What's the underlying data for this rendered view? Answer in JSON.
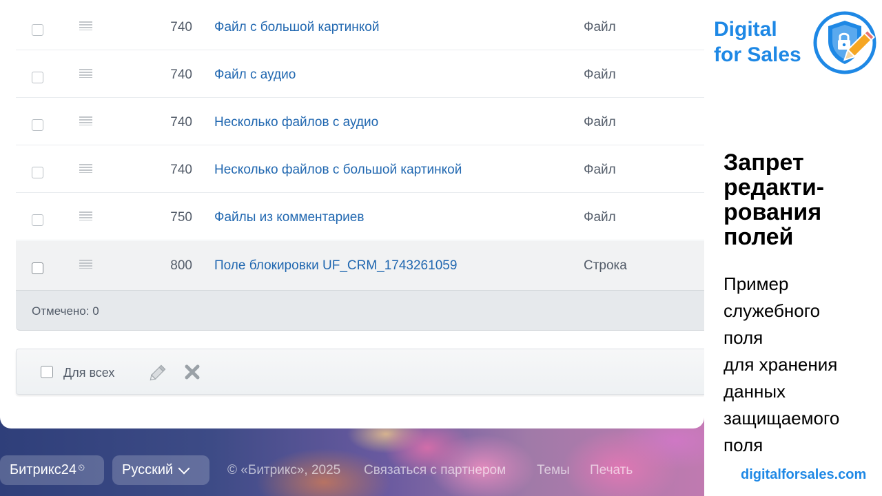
{
  "grid": {
    "rows": [
      {
        "sort": "740",
        "name": "Файл с большой картинкой",
        "type": "Файл",
        "selected": false
      },
      {
        "sort": "740",
        "name": "Файл с аудио",
        "type": "Файл",
        "selected": false
      },
      {
        "sort": "740",
        "name": "Несколько файлов с аудио",
        "type": "Файл",
        "selected": false
      },
      {
        "sort": "740",
        "name": "Несколько файлов с большой картинкой",
        "type": "Файл",
        "selected": false
      },
      {
        "sort": "750",
        "name": "Файлы из комментариев",
        "type": "Файл",
        "selected": false
      },
      {
        "sort": "800",
        "name": "Поле блокировки UF_CRM_1743261059",
        "type": "Строка",
        "selected": true
      }
    ],
    "footer": {
      "checked_label": "Отмечено: 0"
    }
  },
  "action_panel": {
    "for_all_label": "Для всех",
    "edit_icon": "pencil-icon",
    "delete_icon": "close-icon"
  },
  "bottom_bar": {
    "b24_label": "Битрикс24",
    "b24_mark": "⏲",
    "language": "Русский",
    "copyright": "© «Битрикс», 2025",
    "partner_link": "Связаться с партнером",
    "themes_link": "Темы",
    "print_link": "Печать"
  },
  "promo": {
    "brand": "Digital\nfor Sales",
    "title": "Запрет\nредакти-\nрования\nполей",
    "description": "Пример\nслужебного\nполя\nдля хранения\nданных\nзащищаемого\nполя",
    "url": "digitalforsales.com"
  },
  "colors": {
    "link": "#2067b0",
    "text": "#535c69",
    "brand_blue": "#1e88e5",
    "selected_row": "#f1f2f3"
  }
}
